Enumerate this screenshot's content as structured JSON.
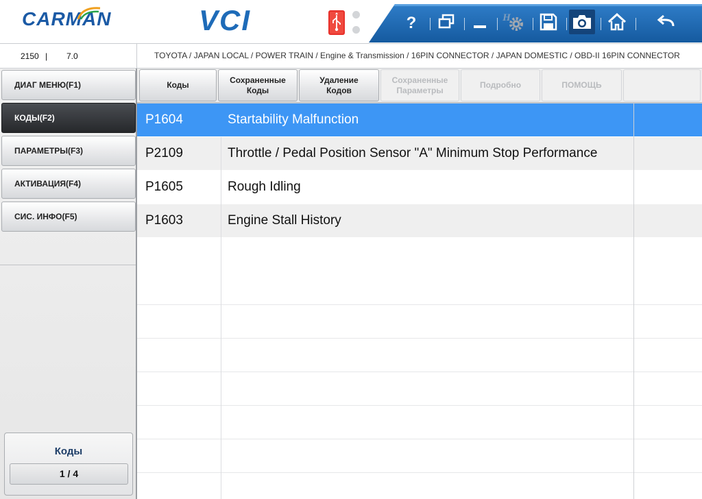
{
  "header": {
    "logo_text": "CARMAN",
    "product": "VCI",
    "icons": [
      "usb-icon",
      "help-icon",
      "window-icon",
      "minimize-icon",
      "settings-icon",
      "save-icon",
      "camera-icon",
      "home-icon",
      "back-icon"
    ],
    "colors": {
      "toolbar_blue": "#1d64ad",
      "logo_blue": "#1b5aa5",
      "usb_red": "#e8312b"
    }
  },
  "status": {
    "a": "2150",
    "b": "|",
    "c": "7.0",
    "breadcrumb": "TOYOTA / JAPAN LOCAL / POWER TRAIN / Engine & Transmission / 16PIN CONNECTOR / JAPAN DOMESTIC / OBD-II 16PIN CONNECTOR"
  },
  "sidebar": {
    "items": [
      {
        "label": "ДИАГ МЕНЮ(F1)",
        "active": false
      },
      {
        "label": "КОДЫ(F2)",
        "active": true
      },
      {
        "label": "ПАРАМЕТРЫ(F3)",
        "active": false
      },
      {
        "label": "АКТИВАЦИЯ(F4)",
        "active": false
      },
      {
        "label": "СИС. ИНФО(F5)",
        "active": false
      }
    ],
    "status_title": "Коды",
    "page_indicator": "1 / 4"
  },
  "tabs": [
    {
      "label": "Коды",
      "enabled": true
    },
    {
      "label": "Сохраненные Коды",
      "enabled": true
    },
    {
      "label": "Удаление Кодов",
      "enabled": true
    },
    {
      "label": "Сохраненные Параметры",
      "enabled": false
    },
    {
      "label": "Подробно",
      "enabled": false
    },
    {
      "label": "ПОМОЩЬ",
      "enabled": false
    }
  ],
  "table": {
    "rows": [
      {
        "code": "P1604",
        "description": "Startability Malfunction",
        "selected": true
      },
      {
        "code": "P2109",
        "description": "Throttle / Pedal Position Sensor \"A\" Minimum Stop Performance",
        "selected": false
      },
      {
        "code": "P1605",
        "description": "Rough Idling",
        "selected": false
      },
      {
        "code": "P1603",
        "description": "Engine Stall History",
        "selected": false
      }
    ],
    "selected_color": "#3d96f5"
  }
}
